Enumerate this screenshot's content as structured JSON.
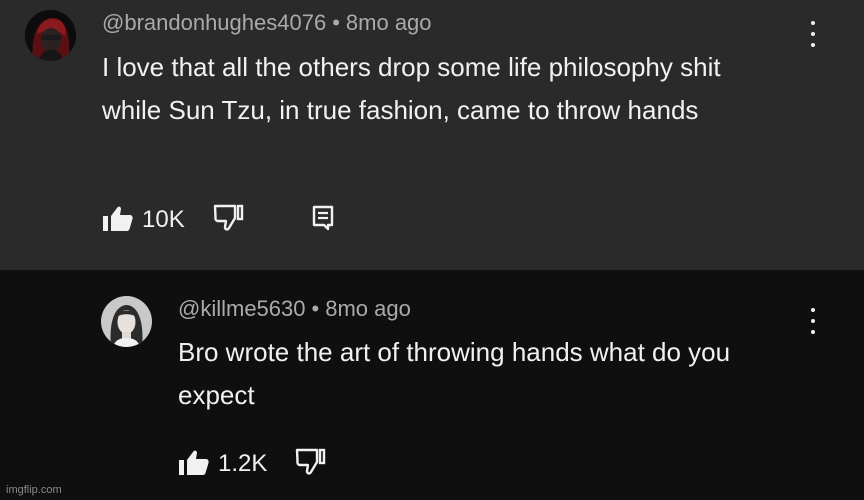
{
  "comments": [
    {
      "username": "@brandonhughes4076",
      "separator": "•",
      "time": "8mo ago",
      "text": "I love that all the others drop some life philosophy shit while Sun Tzu, in true fashion, came to throw hands",
      "likes": "10K"
    },
    {
      "username": "@killme5630",
      "separator": "•",
      "time": "8mo ago",
      "text": "Bro wrote the art of throwing hands what do you expect",
      "likes": "1.2K"
    }
  ],
  "watermark": "imgflip.com"
}
